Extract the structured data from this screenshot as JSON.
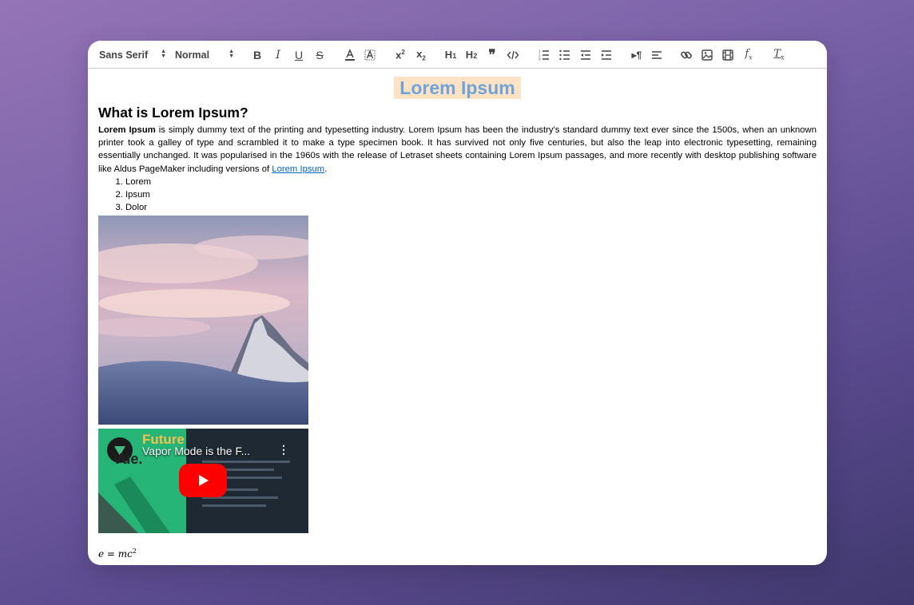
{
  "toolbar": {
    "font_picker": "Sans Serif",
    "size_picker": "Normal"
  },
  "document": {
    "title": "Lorem Ipsum",
    "heading": "What is Lorem Ipsum?",
    "paragraph_bold": "Lorem Ipsum",
    "paragraph_text": " is simply dummy text of the printing and typesetting industry. Lorem Ipsum has been the industry's standard dummy text ever since the 1500s, when an unknown printer took a galley of type and scrambled it to make a type specimen book. It has survived not only five centuries, but also the leap into electronic typesetting, remaining essentially unchanged. It was popularised in the 1960s with the release of Letraset sheets containing Lorem Ipsum passages, and more recently with desktop publishing software like Aldus PageMaker including versions of ",
    "paragraph_link": "Lorem Ipsum",
    "paragraph_end": ".",
    "list": [
      "Lorem",
      "Ipsum",
      "Dolor"
    ],
    "video": {
      "title": "Vapor Mode is the F...",
      "channel_text": "Future",
      "logo_text": "Vue."
    },
    "formula": {
      "lhs": "e",
      "eq": " = ",
      "rhs": "mc",
      "exp": "2"
    }
  },
  "colors": {
    "title_text": "#6fa4d8",
    "title_highlight": "#fde2c6",
    "link": "#0066cc",
    "youtube_red": "#ff0000"
  }
}
